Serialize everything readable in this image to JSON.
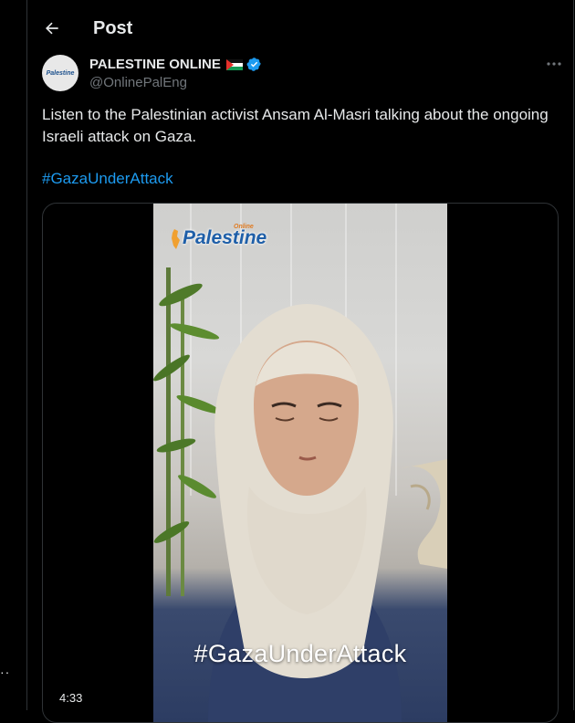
{
  "header": {
    "title": "Post"
  },
  "left_rail": {
    "dots": "··"
  },
  "author": {
    "avatar_text": "Palestine",
    "name": "PALESTINE ONLINE",
    "handle": "@OnlinePalEng",
    "more_label": "···"
  },
  "tweet": {
    "text": "Listen to the Palestinian activist Ansam Al-Masri talking about the ongoing Israeli attack on Gaza.",
    "hashtag": "#GazaUnderAttack"
  },
  "media": {
    "watermark": "Palestine",
    "watermark_sub": "Online",
    "overlay_text": "#GazaUnderAttack",
    "duration": "4:33"
  },
  "colors": {
    "background": "#000000",
    "text_primary": "#e7e9ea",
    "text_secondary": "#71767b",
    "link": "#1d9bf0",
    "border": "#2f3336",
    "verified": "#1d9bf0"
  }
}
